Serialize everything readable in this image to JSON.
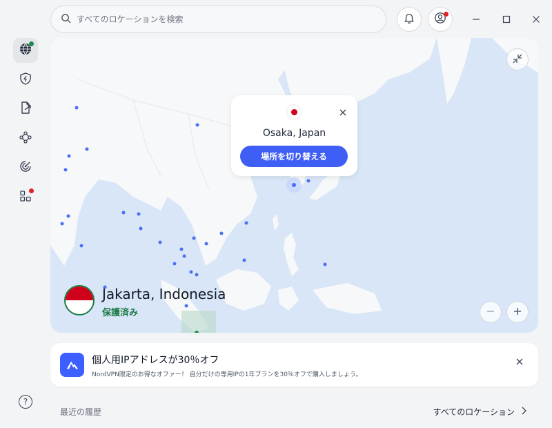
{
  "search": {
    "placeholder": "すべてのロケーションを検索"
  },
  "popup": {
    "location": "Osaka, Japan",
    "switch_label": "場所を切り替える",
    "flag_color": "#d0021b"
  },
  "connection": {
    "location": "Jakarta, Indonesia",
    "status": "保護済み",
    "status_color": "#1b7a44"
  },
  "promo": {
    "title": "個人用IPアドレスが30％オフ",
    "description": "NordVPN限定のお得なオファー！ 自分だけの専用IPの1年プランを30％オフで購入しましょう。"
  },
  "footer": {
    "recent_label": "最近の履歴",
    "all_locations_label": "すべてのロケーション"
  },
  "help_icon_label": "?",
  "sidebar": {
    "items": [
      {
        "icon": "globe-icon",
        "active": true,
        "badge": "green"
      },
      {
        "icon": "shield-bolt-icon"
      },
      {
        "icon": "file-share-icon"
      },
      {
        "icon": "meshnet-icon"
      },
      {
        "icon": "radar-icon"
      },
      {
        "icon": "apps-icon",
        "badge": "red"
      }
    ]
  },
  "colors": {
    "accent": "#3f5ef6",
    "map_water": "#d9e6f7",
    "map_land": "#f7f8f9",
    "server_dot": "#4c6ef5"
  }
}
